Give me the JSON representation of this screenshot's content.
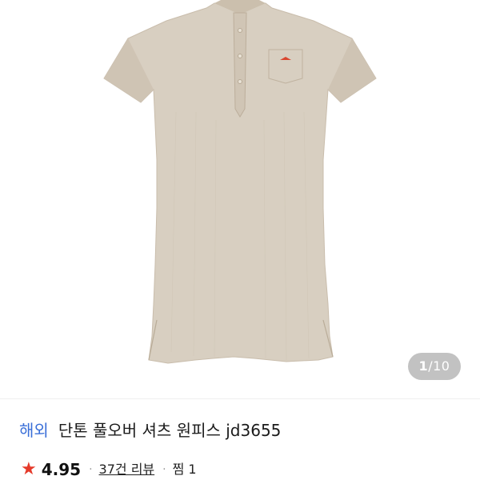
{
  "gallery": {
    "image_alt": "product-photo-shirt-dress",
    "counter_current": "1",
    "counter_separator": "/",
    "counter_total": "10",
    "colors": {
      "fabric": "#d6ccbe",
      "fabric_shadow": "#c6baa9",
      "logo": "#d9462f"
    }
  },
  "product": {
    "origin_badge": "해외",
    "name": "단톤 풀오버 셔츠 원피스 jd3655"
  },
  "meta": {
    "star_icon": "star-icon",
    "rating": "4.95",
    "dot": "·",
    "reviews_label": "37건 리뷰",
    "dot2": "·",
    "likes_label": "찜 1"
  }
}
